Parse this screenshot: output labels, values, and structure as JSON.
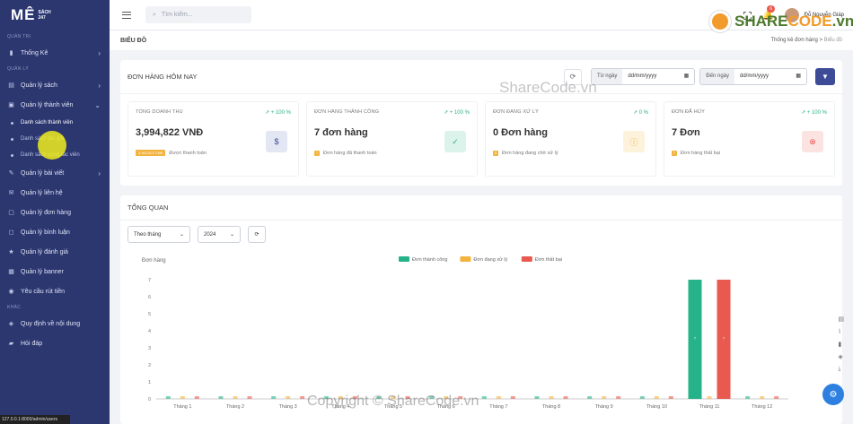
{
  "sidebar": {
    "logo_text": "MÊ",
    "logo_small_1": "SÁCH",
    "logo_small_2": "247",
    "sections": {
      "admin": "QUẢN TRỊ",
      "manage": "QUẢN LÝ",
      "other": "KHÁC"
    },
    "items": {
      "stats": "Thống Kê",
      "books": "Quản lý sách",
      "members": "Quản lý thành viên",
      "sub_members": "Danh sách thành viên",
      "sub_2": "Danh sách tác giả",
      "sub_3": "Danh sách cộng tác viên",
      "posts": "Quản lý bài viết",
      "contacts": "Quản lý liên hệ",
      "orders": "Quản lý đơn hàng",
      "comments": "Quản lý bình luận",
      "reviews": "Quản lý đánh giá",
      "banner": "Quản lý banner",
      "withdraw": "Yêu cầu rút tiền",
      "rules": "Quy định về nội dung",
      "faq": "Hỏi đáp"
    },
    "status_url": "127.0.0.1:8000/admin/users"
  },
  "topbar": {
    "search_placeholder": "Tìm kiếm...",
    "notif_count": "6",
    "user_name": "Đỗ Nguyễn Giáp"
  },
  "page": {
    "title": "BIỂU ĐỒ",
    "crumb_1": "Thống kê đơn hàng",
    "crumb_sep": ">",
    "crumb_2": "Biểu đồ"
  },
  "today": {
    "title": "ĐƠN HÀNG HÔM NAY",
    "from_label": "Từ ngày",
    "to_label": "Đến ngày",
    "date_placeholder": "dd/mm/yyyy",
    "cards": [
      {
        "label": "TỔNG DOANH THU",
        "pct": "↗ + 100 %",
        "value": "3,994,822 VNĐ",
        "chip": "3,994,822 VNĐ",
        "note": "Được thanh toán",
        "color": "#3e4b97",
        "bg": "#e3e6f3"
      },
      {
        "label": "ĐƠN HÀNG THÀNH CÔNG",
        "pct": "↗ + 100 %",
        "value": "7 đơn hàng",
        "chip": "7",
        "note": "Đơn hàng đã thanh toán",
        "color": "#27b28a",
        "bg": "#dcf3ec"
      },
      {
        "label": "ĐƠN ĐANG XỬ LÝ",
        "pct": "↗ 0 %",
        "value": "0 Đơn hàng",
        "chip": "0",
        "note": "Đơn hàng đang chờ xử lý",
        "color": "#f2b33f",
        "bg": "#fdf2dc"
      },
      {
        "label": "ĐƠN ĐÃ HỦY",
        "pct": "↗ + 100 %",
        "value": "7 Đơn",
        "chip": "7",
        "note": "Đơn hàng thất bại",
        "color": "#e85a4f",
        "bg": "#fbe3e1"
      }
    ]
  },
  "overview": {
    "title": "TỔNG QUAN",
    "period": "Theo tháng",
    "year": "2024"
  },
  "chart_data": {
    "type": "bar",
    "ylabel": "Đơn hàng",
    "ylim": [
      0,
      7
    ],
    "yticks": [
      0,
      1,
      2,
      3,
      4,
      5,
      6,
      7
    ],
    "categories": [
      "Tháng 1",
      "Tháng 2",
      "Tháng 3",
      "Tháng 4",
      "Tháng 5",
      "Tháng 6",
      "Tháng 7",
      "Tháng 8",
      "Tháng 9",
      "Tháng 10",
      "Tháng 11",
      "Tháng 12"
    ],
    "series": [
      {
        "name": "Đơn thành công",
        "color": "#26b38a",
        "values": [
          0,
          0,
          0,
          0,
          0,
          0,
          0,
          0,
          0,
          0,
          7,
          0
        ]
      },
      {
        "name": "Đơn đang xử lý",
        "color": "#f2b33f",
        "values": [
          0,
          0,
          0,
          0,
          0,
          0,
          0,
          0,
          0,
          0,
          0,
          0
        ]
      },
      {
        "name": "Đơn thất bại",
        "color": "#e85a4f",
        "values": [
          0,
          0,
          0,
          0,
          0,
          0,
          0,
          0,
          0,
          0,
          7,
          0
        ]
      }
    ],
    "legend": "top-center",
    "grid": false
  },
  "watermark": {
    "brand_a": "SHARE",
    "brand_b": "CODE",
    "brand_c": ".vn",
    "center": "ShareCode.vn",
    "bottom": "Copyright © ShareCode.vn"
  }
}
